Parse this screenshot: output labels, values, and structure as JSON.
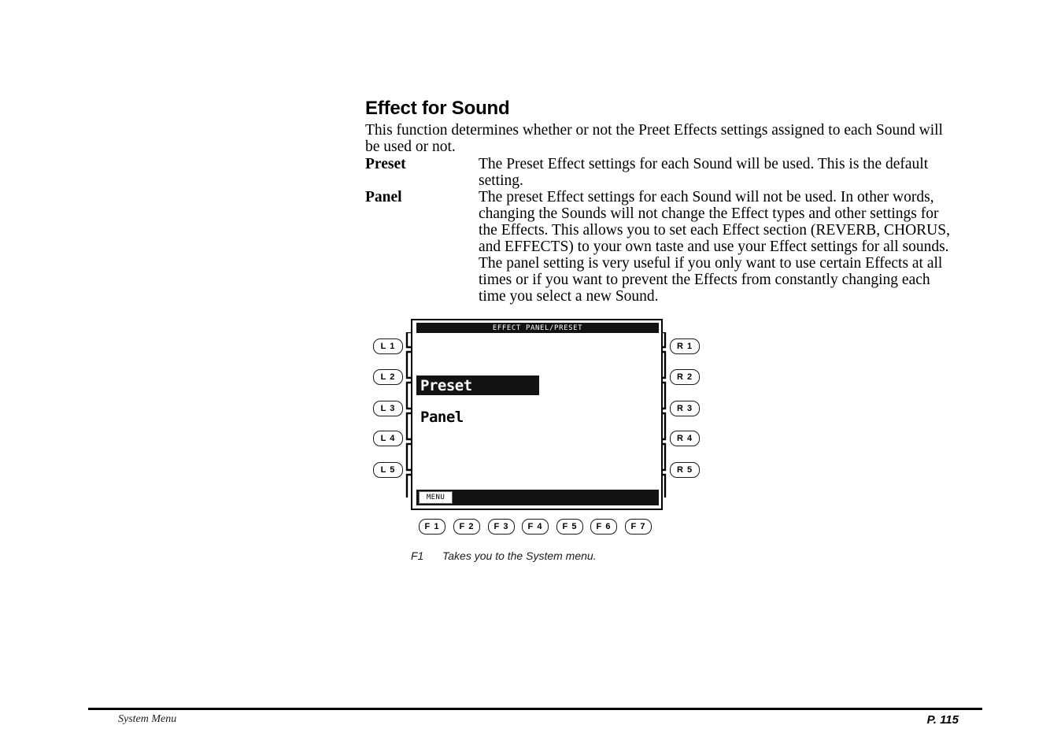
{
  "page": {
    "title": "Effect for Sound",
    "intro": "This function determines whether or not the Preet Effects settings assigned to each Sound will be used or not."
  },
  "options": [
    {
      "term": "Preset",
      "description": "The Preset Effect settings for each Sound will be used.  This is the default setting."
    },
    {
      "term": "Panel",
      "description": "The preset Effect settings for each Sound will not be used.  In other words, changing the Sounds will not change the Effect types and other settings for the Effects.  This allows you to set each Effect section (REVERB, CHORUS, and EFFECTS) to your own taste and use your Effect settings for all sounds.  The panel setting is very useful if you only want to use certain Effects at all times or if you want to prevent the Effects from constantly changing each time you select a new Sound."
    }
  ],
  "device": {
    "lcd": {
      "title": "EFFECT PANEL/PRESET",
      "options": [
        {
          "label": "Preset",
          "selected": true
        },
        {
          "label": "Panel",
          "selected": false
        }
      ],
      "soft_button": "MENU"
    },
    "left_buttons": [
      "L 1",
      "L 2",
      "L 3",
      "L 4",
      "L 5"
    ],
    "right_buttons": [
      "R 1",
      "R 2",
      "R 3",
      "R 4",
      "R 5"
    ],
    "function_buttons": [
      "F 1",
      "F 2",
      "F 3",
      "F 4",
      "F 5",
      "F 6",
      "F 7"
    ]
  },
  "caption": {
    "key": "F1",
    "text": "Takes you to the System menu."
  },
  "footer": {
    "section": "System Menu",
    "page_number": "P. 115"
  },
  "colors": {
    "ink": "#000000",
    "lcd_background": "#ffffff",
    "lcd_highlight": "#131313"
  }
}
